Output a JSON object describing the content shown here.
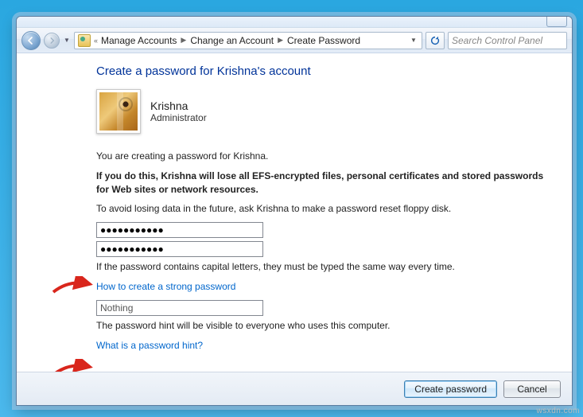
{
  "breadcrumb": {
    "items": [
      "Manage Accounts",
      "Change an Account",
      "Create Password"
    ]
  },
  "search": {
    "placeholder": "Search Control Panel"
  },
  "page": {
    "title": "Create a password for Krishna's account",
    "user": {
      "name": "Krishna",
      "role": "Administrator"
    },
    "intro": "You are creating a password for Krishna.",
    "warning": "If you do this, Krishna will lose all EFS-encrypted files, personal certificates and stored passwords for Web sites or network resources.",
    "avoid": "To avoid losing data in the future, ask Krishna to make a password reset floppy disk.",
    "pw_value": "●●●●●●●●●●●",
    "pw_confirm_value": "●●●●●●●●●●●",
    "caps_note": "If the password contains capital letters, they must be typed the same way every time.",
    "strong_link": "How to create a strong password",
    "hint_value": "Nothing",
    "hint_note": "The password hint will be visible to everyone who uses this computer.",
    "hint_link": "What is a password hint?"
  },
  "footer": {
    "create": "Create password",
    "cancel": "Cancel"
  },
  "watermark": "wsxdn.com"
}
